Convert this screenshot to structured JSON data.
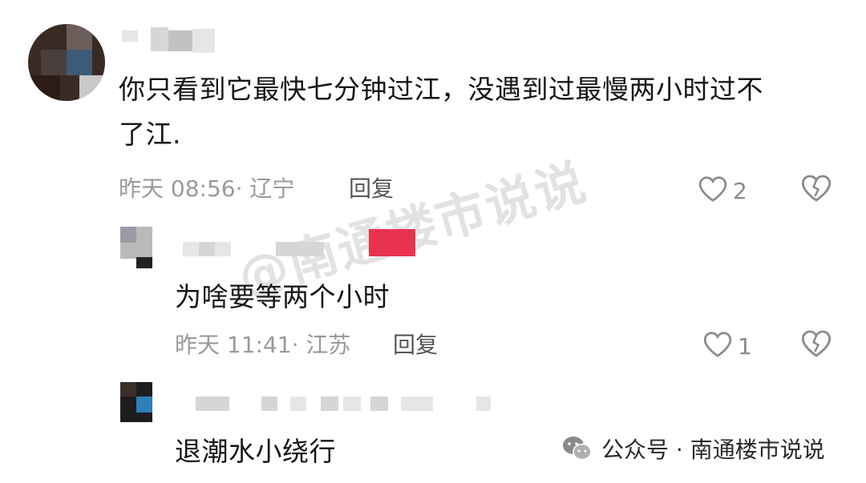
{
  "comments": [
    {
      "text_line1": "你只看到它最快七分钟过江，没遇到过最慢两小时过不",
      "text_line2": "了江.",
      "meta": "昨天 08:56· 辽宁",
      "reply_label": "回复",
      "likes": "2"
    },
    {
      "text": "为啥要等两个小时",
      "meta": "昨天 11:41· 江苏",
      "reply_label": "回复",
      "likes": "1"
    },
    {
      "text": "退潮水小绕行"
    }
  ],
  "watermark": "@南通楼市说说",
  "footer": {
    "brand": "公众号 · 南通楼市说说"
  },
  "icons": {
    "like": "heart-outline-icon",
    "dislike": "broken-heart-icon",
    "brand": "wechat-icon"
  },
  "colors": {
    "text": "#161616",
    "meta": "#9a9a9a",
    "badge": "#e8334f"
  }
}
